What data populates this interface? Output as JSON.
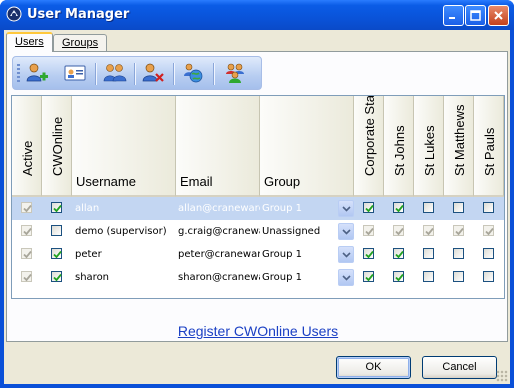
{
  "window": {
    "title": "User Manager"
  },
  "tabs": [
    {
      "label": "Users"
    },
    {
      "label": "Groups"
    }
  ],
  "toolbar": {
    "buttons": [
      {
        "icon": "add-user-icon"
      },
      {
        "icon": "user-card-icon"
      },
      {
        "icon": "users-group-icon"
      },
      {
        "icon": "delete-user-icon"
      },
      {
        "icon": "globe-user-icon"
      },
      {
        "icon": "group-icon"
      }
    ]
  },
  "grid": {
    "columns": {
      "active": "Active",
      "cwonline": "CWOnline",
      "username": "Username",
      "email": "Email",
      "group": "Group",
      "corporate": "Corporate Sta.",
      "stjohns": "St Johns",
      "stlukes": "St Lukes",
      "stmatthews": "St Matthews",
      "stpauls": "St Pauls"
    },
    "rows": [
      {
        "username": "allan",
        "email": "allan@craneware",
        "group": "Group 1",
        "active": true,
        "cwonline": true,
        "corporate": true,
        "stjohns": true,
        "stlukes": false,
        "stmatthews": false,
        "stpauls": false,
        "selected": true
      },
      {
        "username": "demo (supervisor)",
        "email": "g.craig@cranewa",
        "group": "Unassigned",
        "active": true,
        "cwonline": false,
        "corporate": true,
        "stjohns": true,
        "stlukes": true,
        "stmatthews": true,
        "stpauls": true,
        "selected": false
      },
      {
        "username": "peter",
        "email": "peter@craneware",
        "group": "Group 1",
        "active": true,
        "cwonline": true,
        "corporate": true,
        "stjohns": true,
        "stlukes": false,
        "stmatthews": false,
        "stpauls": false,
        "selected": false
      },
      {
        "username": "sharon",
        "email": "sharon@cranewar",
        "group": "Group 1",
        "active": true,
        "cwonline": true,
        "corporate": true,
        "stjohns": true,
        "stlukes": false,
        "stmatthews": false,
        "stpauls": false,
        "selected": false
      }
    ]
  },
  "register_link": "Register CWOnline Users",
  "buttons": {
    "ok": "OK",
    "cancel": "Cancel"
  },
  "colors": {
    "titlebar": "#0a53d9",
    "selection": "#c3d6f2",
    "link": "#1a3fc4"
  }
}
